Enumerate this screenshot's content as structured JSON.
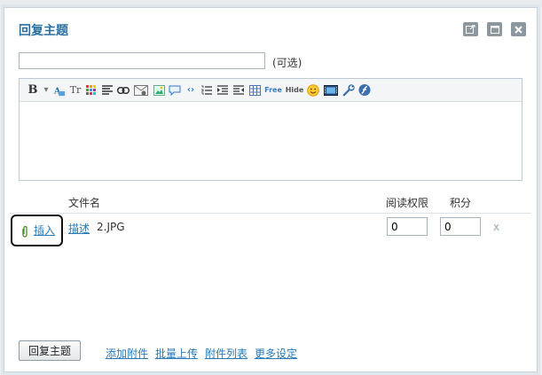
{
  "dialog": {
    "title": "回复主题",
    "subject": {
      "value": "",
      "optional_label": "(可选)"
    },
    "toolbar": [
      {
        "name": "bold-icon",
        "glyph": "B"
      },
      {
        "name": "dropdown-arrow-icon",
        "glyph": "▾"
      },
      {
        "name": "font-color-icon",
        "glyph": "A"
      },
      {
        "name": "font-size-icon",
        "glyph": "Tr"
      },
      {
        "name": "color-grid-icon",
        "glyph": ""
      },
      {
        "name": "align-icon",
        "glyph": "≡"
      },
      {
        "name": "link-icon",
        "glyph": "∞"
      },
      {
        "name": "email-icon",
        "glyph": ""
      },
      {
        "name": "image-icon",
        "glyph": ""
      },
      {
        "name": "quote-icon",
        "glyph": ""
      },
      {
        "name": "code-icon",
        "glyph": "‹›"
      },
      {
        "name": "ordered-list-icon",
        "glyph": ""
      },
      {
        "name": "indent-icon",
        "glyph": ""
      },
      {
        "name": "outdent-icon",
        "glyph": ""
      },
      {
        "name": "table-icon",
        "glyph": ""
      },
      {
        "name": "free-icon",
        "glyph": "Free"
      },
      {
        "name": "hide-icon",
        "glyph": "Hide"
      },
      {
        "name": "smiley-icon",
        "glyph": ""
      },
      {
        "name": "media-icon",
        "glyph": ""
      },
      {
        "name": "tool-icon",
        "glyph": ""
      },
      {
        "name": "flash-icon",
        "glyph": ""
      }
    ],
    "attachments": {
      "header": {
        "filename": "文件名",
        "read_permission": "阅读权限",
        "score": "积分"
      },
      "rows": [
        {
          "insert_label": "插入",
          "desc_label": "描述",
          "filename": "2.JPG",
          "read_permission": "0",
          "score": "0",
          "delete_label": "x"
        }
      ]
    },
    "submit_label": "回复主题",
    "links": [
      "添加附件",
      "批量上传",
      "附件列表",
      "更多设定"
    ]
  }
}
